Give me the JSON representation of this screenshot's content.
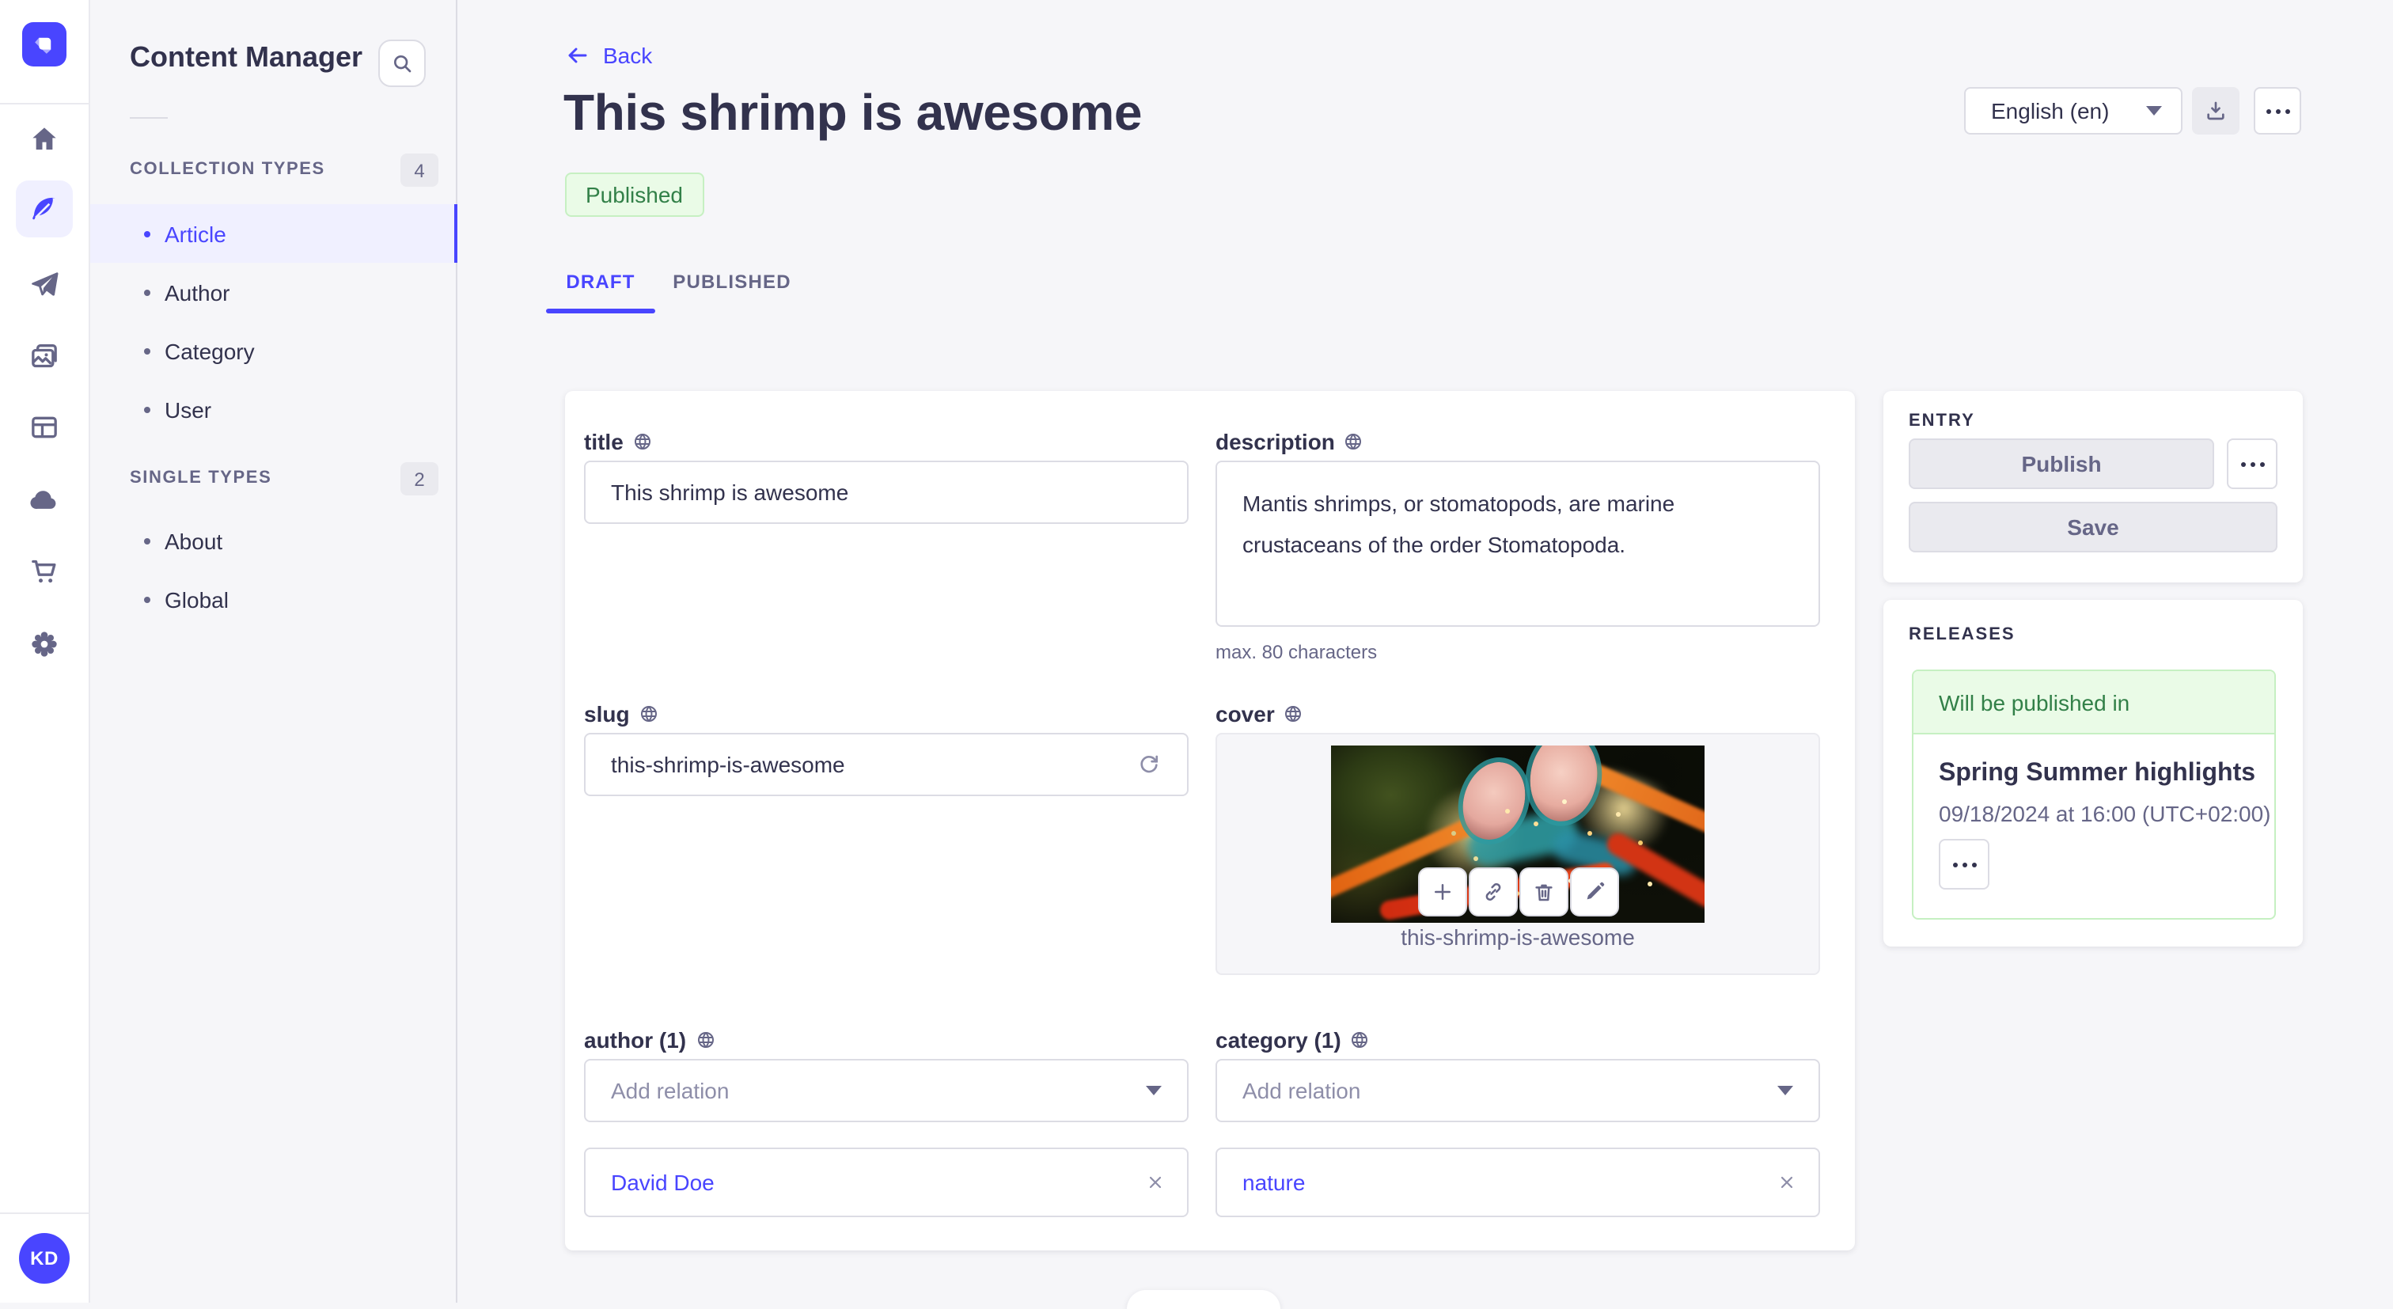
{
  "colors": {
    "primary": "#4945ff",
    "primary_bg": "#f0f0ff",
    "text": "#32324d",
    "text_muted": "#666687",
    "placeholder": "#8e8ea9",
    "border": "#dcdce4",
    "page_bg": "#f6f6f9",
    "success_text": "#328048",
    "success_bg": "#eafbe7",
    "success_border": "#c6f0c2"
  },
  "rail": {
    "logo": "strapi-logo",
    "items": [
      {
        "icon": "home-icon"
      },
      {
        "icon": "content-manager-feather-icon",
        "active": true
      },
      {
        "icon": "send-plane-icon"
      },
      {
        "icon": "media-library-icon"
      },
      {
        "icon": "content-type-builder-icon"
      },
      {
        "icon": "cloud-icon"
      },
      {
        "icon": "marketplace-cart-icon"
      },
      {
        "icon": "settings-gear-icon"
      }
    ],
    "user_initials": "KD"
  },
  "sidebar": {
    "title": "Content Manager",
    "sections": [
      {
        "label": "COLLECTION TYPES",
        "count": "4",
        "items": [
          {
            "label": "Article",
            "active": true
          },
          {
            "label": "Author"
          },
          {
            "label": "Category"
          },
          {
            "label": "User"
          }
        ]
      },
      {
        "label": "SINGLE TYPES",
        "count": "2",
        "items": [
          {
            "label": "About"
          },
          {
            "label": "Global"
          }
        ]
      }
    ]
  },
  "header": {
    "back": "Back",
    "title": "This shrimp is awesome",
    "status": "Published",
    "locale": "English (en)",
    "tabs": [
      {
        "label": "DRAFT",
        "active": true
      },
      {
        "label": "PUBLISHED"
      }
    ]
  },
  "form": {
    "title": {
      "label": "title",
      "value": "This shrimp is awesome"
    },
    "description": {
      "label": "description",
      "value": "Mantis shrimps, or stomatopods, are marine crustaceans of the order Stomatopoda.",
      "hint": "max. 80 characters"
    },
    "slug": {
      "label": "slug",
      "value": "this-shrimp-is-awesome"
    },
    "cover": {
      "label": "cover",
      "caption": "this-shrimp-is-awesome"
    },
    "author": {
      "label": "author (1)",
      "placeholder": "Add relation",
      "value": "David Doe"
    },
    "category": {
      "label": "category (1)",
      "placeholder": "Add relation",
      "value": "nature"
    }
  },
  "entry_panel": {
    "title": "ENTRY",
    "publish": "Publish",
    "save": "Save"
  },
  "releases_panel": {
    "title": "RELEASES",
    "status": "Will be published in",
    "release_name": "Spring Summer highlights",
    "release_date": "09/18/2024 at 16:00 (UTC+02:00)"
  }
}
